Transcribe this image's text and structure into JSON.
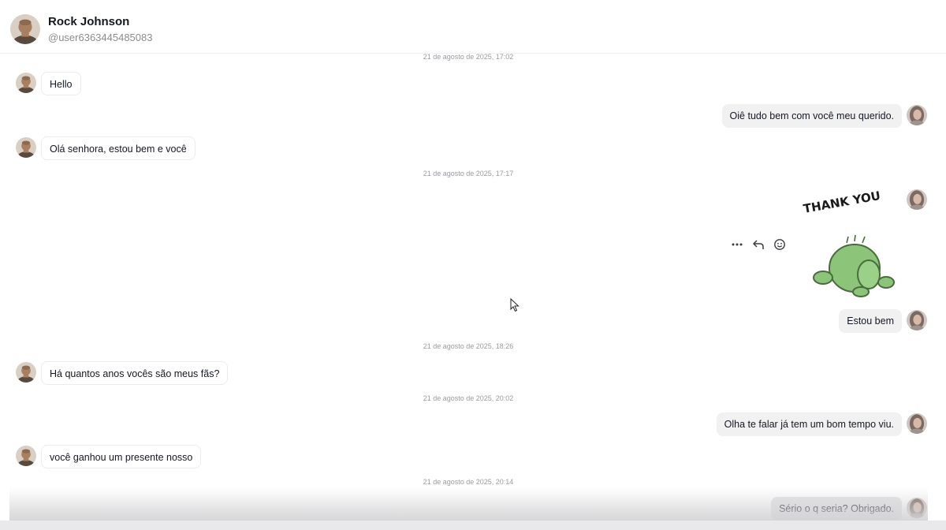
{
  "header": {
    "name": "Rock Johnson",
    "handle": "@user6363445485083"
  },
  "timestamps": [
    "21 de agosto de 2025, 17:02",
    "21 de agosto de 2025, 17:17",
    "21 de agosto de 2025, 18:26",
    "21 de agosto de 2025, 20:02",
    "21 de agosto de 2025, 20:14"
  ],
  "messages": [
    {
      "from": "rock",
      "text": "Hello"
    },
    {
      "from": "me",
      "text": "Oiê tudo bem com você meu querido."
    },
    {
      "from": "rock",
      "text": "Olá senhora, estou bem e você"
    },
    {
      "from": "me",
      "type": "sticker",
      "sticker_text": "THANK YOU"
    },
    {
      "from": "me",
      "text": "Estou bem"
    },
    {
      "from": "rock",
      "text": "Há quantos anos vocês são meus fãs?"
    },
    {
      "from": "me",
      "text": "Olha te falar já tem um bom tempo viu."
    },
    {
      "from": "rock",
      "text": "você ganhou um presente nosso"
    },
    {
      "from": "me",
      "text": "Sério o q seria? Obrigado."
    }
  ],
  "message_actions": [
    "more-icon",
    "reply-icon",
    "emoji-react-icon"
  ],
  "colors": {
    "bubble_out": "#f1f1f2",
    "bubble_in_border": "#ececee",
    "timestamp": "#9a9ba0",
    "sticker_green": "#8cc57a"
  }
}
